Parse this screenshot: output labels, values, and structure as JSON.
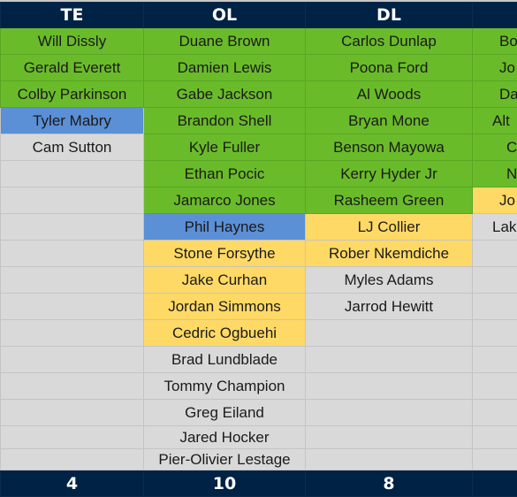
{
  "colors": {
    "green": "#6abb2a",
    "blue": "#5b8fd6",
    "yellow": "#ffd966",
    "gray": "#d9d9d9",
    "header": "#002244"
  },
  "columns": [
    {
      "header": "TE",
      "count": "4",
      "players": [
        {
          "name": "Will Dissly",
          "status": "green"
        },
        {
          "name": "Gerald Everett",
          "status": "green"
        },
        {
          "name": "Colby Parkinson",
          "status": "green"
        },
        {
          "name": "Tyler Mabry",
          "status": "blue"
        },
        {
          "name": "Cam Sutton",
          "status": "gray"
        }
      ]
    },
    {
      "header": "OL",
      "count": "10",
      "players": [
        {
          "name": "Duane Brown",
          "status": "green"
        },
        {
          "name": "Damien Lewis",
          "status": "green"
        },
        {
          "name": "Gabe Jackson",
          "status": "green"
        },
        {
          "name": "Brandon Shell",
          "status": "green"
        },
        {
          "name": "Kyle Fuller",
          "status": "green"
        },
        {
          "name": "Ethan Pocic",
          "status": "green"
        },
        {
          "name": "Jamarco Jones",
          "status": "green"
        },
        {
          "name": "Phil Haynes",
          "status": "blue"
        },
        {
          "name": "Stone Forsythe",
          "status": "yellow"
        },
        {
          "name": "Jake Curhan",
          "status": "yellow"
        },
        {
          "name": "Jordan Simmons",
          "status": "yellow"
        },
        {
          "name": "Cedric Ogbuehi",
          "status": "yellow"
        },
        {
          "name": "Brad Lundblade",
          "status": "gray"
        },
        {
          "name": "Tommy Champion",
          "status": "gray"
        },
        {
          "name": "Greg Eiland",
          "status": "gray"
        },
        {
          "name": "Jared Hocker",
          "status": "gray"
        },
        {
          "name": "Pier-Olivier Lestage",
          "status": "gray"
        }
      ]
    },
    {
      "header": "DL",
      "count": "8",
      "players": [
        {
          "name": "Carlos Dunlap",
          "status": "green"
        },
        {
          "name": "Poona Ford",
          "status": "green"
        },
        {
          "name": "Al Woods",
          "status": "green"
        },
        {
          "name": "Bryan Mone",
          "status": "green"
        },
        {
          "name": "Benson Mayowa",
          "status": "green"
        },
        {
          "name": "Kerry Hyder Jr",
          "status": "green"
        },
        {
          "name": "Rasheem Green",
          "status": "green"
        },
        {
          "name": "LJ Collier",
          "status": "yellow"
        },
        {
          "name": "Rober Nkemdiche",
          "status": "yellow"
        },
        {
          "name": "Myles Adams",
          "status": "gray"
        },
        {
          "name": "Jarrod Hewitt",
          "status": "gray"
        }
      ]
    },
    {
      "header": "",
      "count": "",
      "players": [
        {
          "name": "Bo",
          "status": "green"
        },
        {
          "name": "Jo",
          "status": "green"
        },
        {
          "name": "Da",
          "status": "green"
        },
        {
          "name": "Alt",
          "status": "green"
        },
        {
          "name": "C",
          "status": "green"
        },
        {
          "name": "N",
          "status": "green"
        },
        {
          "name": "Jo",
          "status": "yellow"
        },
        {
          "name": "Lak",
          "status": "gray"
        }
      ]
    }
  ]
}
